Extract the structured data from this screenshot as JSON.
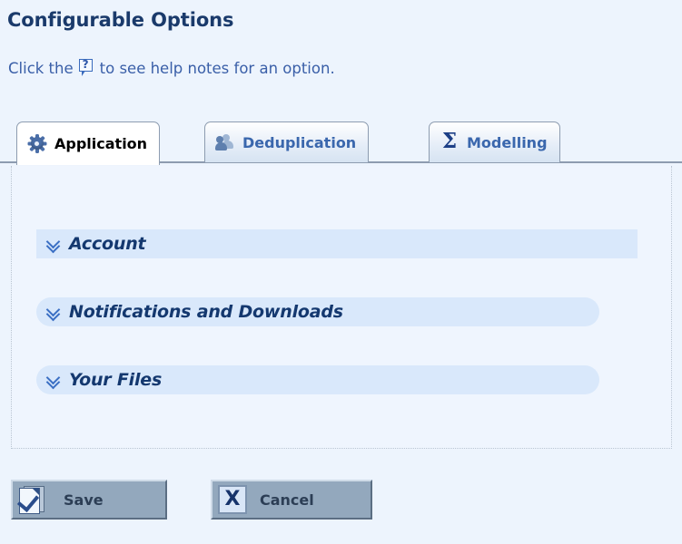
{
  "page": {
    "title": "Configurable Options",
    "subtitle_before": "Click the",
    "subtitle_after": "to see help notes for an option.",
    "help_icon_name": "help-question-bubble-icon",
    "help_icon_glyph": "?"
  },
  "tabs": [
    {
      "label": "Application",
      "icon": "gear-icon",
      "active": true
    },
    {
      "label": "Deduplication",
      "icon": "users-icon",
      "active": false
    },
    {
      "label": "Modelling",
      "icon": "sigma-icon",
      "active": false,
      "glyph": "Σ"
    }
  ],
  "sections": [
    {
      "label": "Account",
      "state": "collapsed",
      "toggle_icon": "double-chevron-down-icon"
    },
    {
      "label": "Notifications and Downloads",
      "state": "collapsed",
      "toggle_icon": "double-chevron-down-icon"
    },
    {
      "label": "Your Files",
      "state": "collapsed",
      "toggle_icon": "double-chevron-down-icon"
    }
  ],
  "buttons": {
    "save": {
      "label": "Save",
      "icon": "page-check-icon"
    },
    "cancel": {
      "label": "Cancel",
      "icon": "x-box-icon",
      "glyph": "X"
    }
  },
  "colors": {
    "page_background": "#edf4fd",
    "panel_background": "#eff5fe",
    "section_bar": "#d9e8fb",
    "heading_text": "#1a3a6b",
    "link_blue": "#3a67ad",
    "button_face": "#93a8bd"
  }
}
